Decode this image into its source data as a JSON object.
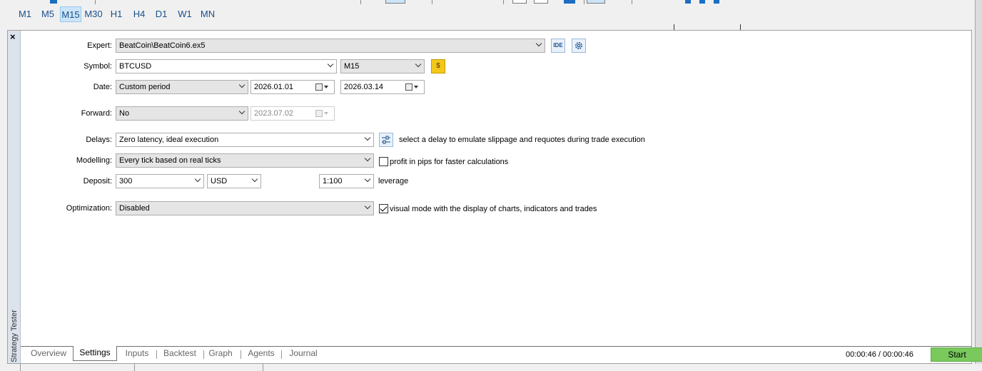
{
  "timeframes": [
    "M1",
    "M5",
    "M15",
    "M30",
    "H1",
    "H4",
    "D1",
    "W1",
    "MN"
  ],
  "active_timeframe": "M15",
  "panel": {
    "close_glyph": "×",
    "vertical_title": "Strategy Tester"
  },
  "settings": {
    "expert": {
      "label": "Expert:",
      "value": "BeatCoin\\BeatCoin6.ex5",
      "ide_label": "IDE"
    },
    "symbol": {
      "label": "Symbol:",
      "value": "BTCUSD",
      "timeframe": "M15",
      "coin_glyph": "$"
    },
    "date": {
      "label": "Date:",
      "period": "Custom period",
      "from": "2026.01.01",
      "to": "2026.03.14"
    },
    "forward": {
      "label": "Forward:",
      "value": "No",
      "date": "2023.07.02"
    },
    "delays": {
      "label": "Delays:",
      "value": "Zero latency, ideal execution",
      "hint": "select a delay to emulate slippage and requotes during trade execution"
    },
    "modelling": {
      "label": "Modelling:",
      "value": "Every tick based on real ticks",
      "checkbox_label": "profit in pips for faster calculations",
      "checked": false
    },
    "deposit": {
      "label": "Deposit:",
      "value": "300",
      "currency": "USD",
      "leverage": "1:100",
      "leverage_label": "leverage"
    },
    "optimization": {
      "label": "Optimization:",
      "value": "Disabled",
      "checkbox_label": "visual mode with the display of charts, indicators and trades",
      "checked": true
    }
  },
  "tabs": [
    {
      "label": "Overview",
      "active": false
    },
    {
      "label": "Settings",
      "active": true
    },
    {
      "label": "Inputs",
      "active": false
    },
    {
      "label": "Backtest",
      "active": false
    },
    {
      "label": "Graph",
      "active": false
    },
    {
      "label": "Agents",
      "active": false
    },
    {
      "label": "Journal",
      "active": false
    }
  ],
  "timer": "00:00:46 / 00:00:46",
  "start_label": "Start",
  "colors": {
    "start": "#79c95d",
    "active_tf": "#cce4f7",
    "panel_bar": "#dce3ec"
  }
}
